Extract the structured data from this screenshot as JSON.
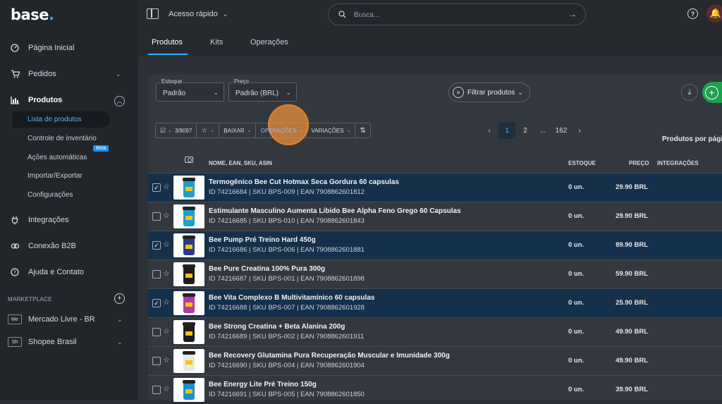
{
  "brand": {
    "name": "base",
    "dot": "."
  },
  "sidebar": {
    "items": [
      {
        "label": "Página Inicial"
      },
      {
        "label": "Pedidos"
      },
      {
        "label": "Produtos"
      },
      {
        "label": "Integrações"
      },
      {
        "label": "Conexão B2B"
      },
      {
        "label": "Ajuda e Contato"
      }
    ],
    "products_sub": [
      {
        "label": "Lista de produtos"
      },
      {
        "label": "Controle de inventário"
      },
      {
        "label": "Ações automáticas",
        "badge": "Beta"
      },
      {
        "label": "Importar/Exportar"
      },
      {
        "label": "Configurações"
      }
    ],
    "marketplace_label": "MARKETPLACE",
    "marketplaces": [
      {
        "badge": "Me",
        "label": "Mercado Livre - BR"
      },
      {
        "badge": "Sh",
        "label": "Shopee Brasil"
      }
    ]
  },
  "topbar": {
    "quick_access": "Acesso rápido",
    "search_placeholder": "Busca...",
    "tabs": [
      {
        "label": "Produtos"
      },
      {
        "label": "Kits"
      },
      {
        "label": "Operações"
      }
    ]
  },
  "filters": {
    "stock": {
      "label": "Estoque",
      "value": "Padrão"
    },
    "price": {
      "label": "Preço",
      "value": "Padrão (BRL)"
    },
    "filter_button": "Filtrar produtos"
  },
  "toolbar": {
    "selection": "3/8097",
    "download": "BAIXAR",
    "operations": "OPERAÇÕES",
    "variations": "VARIAÇÕES"
  },
  "pagination": {
    "current": "1",
    "next": "2",
    "ellipsis": "...",
    "last": "162"
  },
  "per_page_label": "Produtos por pági",
  "table": {
    "headers": {
      "name": "NOME, EAN, SKU, ASIN",
      "stock": "ESTOQUE",
      "price": "PREÇO",
      "integrations": "INTEGRAÇÕES"
    },
    "rows": [
      {
        "checked": true,
        "name": "Termogênico Bee Cut Hotmax Seca Gordura 60 capsulas",
        "meta": "ID 74216684 | SKU BPS-009 | EAN 7908862601812",
        "stock": "0 un.",
        "price": "29.90 BRL",
        "jar": "#1a9ed6"
      },
      {
        "checked": false,
        "name": "Estimulante Masculino Aumenta Libido Bee Alpha Feno Grego 60 Capsulas",
        "meta": "ID 74216685 | SKU BPS-010 | EAN 7908862601843",
        "stock": "0 un.",
        "price": "29.90 BRL",
        "jar": "#1a9ed6"
      },
      {
        "checked": true,
        "name": "Bee Pump Pré Treino Hard 450g",
        "meta": "ID 74216686 | SKU BPS-006 | EAN 7908862601881",
        "stock": "0 un.",
        "price": "89.90 BRL",
        "jar": "#2a3b8f"
      },
      {
        "checked": false,
        "name": "Bee Pure Creatina 100% Pura 300g",
        "meta": "ID 74216687 | SKU BPS-001 | EAN 7908862601898",
        "stock": "0 un.",
        "price": "59.90 BRL",
        "jar": "#1d1d1d"
      },
      {
        "checked": true,
        "name": "Bee Vita Complexo B Multivitamínico 60 capsulas",
        "meta": "ID 74216688 | SKU BPS-007 | EAN 7908862601928",
        "stock": "0 un.",
        "price": "25.90 BRL",
        "jar": "#b23aa8"
      },
      {
        "checked": false,
        "name": "Bee Strong Creatina + Beta Alanina 200g",
        "meta": "ID 74216689 | SKU BPS-002 | EAN 7908862601911",
        "stock": "0 un.",
        "price": "49.90 BRL",
        "jar": "#1d1d1d"
      },
      {
        "checked": false,
        "name": "Bee Recovery Glutamina Pura Recuperação Muscular e Imunidade 300g",
        "meta": "ID 74216690 | SKU BPS-004 | EAN 7908862601904",
        "stock": "0 un.",
        "price": "49.90 BRL",
        "jar": "#e8e8e8"
      },
      {
        "checked": false,
        "name": "Bee Energy Lite Pré Treino 150g",
        "meta": "ID 74216691 | SKU BPS-005 | EAN 7908862601850",
        "stock": "0 un.",
        "price": "39.90 BRL",
        "jar": "#1a8fcf"
      }
    ]
  },
  "colors": {
    "accent": "#1fb3ff",
    "add_button": "#1ca14d",
    "highlight": "#e6822a",
    "selected_row": "#15304a"
  }
}
